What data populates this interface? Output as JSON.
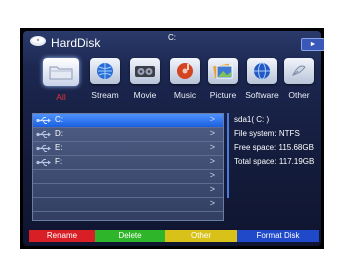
{
  "header": {
    "title": "HardDisk",
    "drive_path": "C:",
    "nav_button_symbol": "►"
  },
  "categories": [
    {
      "label": "All",
      "icon": "folder-icon",
      "active": true
    },
    {
      "label": "Stream",
      "icon": "stream-icon",
      "active": false
    },
    {
      "label": "Movie",
      "icon": "movie-icon",
      "active": false
    },
    {
      "label": "Music",
      "icon": "music-icon",
      "active": false
    },
    {
      "label": "Picture",
      "icon": "picture-icon",
      "active": false
    },
    {
      "label": "Software",
      "icon": "software-icon",
      "active": false
    },
    {
      "label": "Other",
      "icon": "other-icon",
      "active": false
    }
  ],
  "file_list": {
    "rows": [
      {
        "name": "C:",
        "icon": "usb-icon",
        "arrow": ">",
        "selected": true
      },
      {
        "name": "D:",
        "icon": "usb-icon",
        "arrow": ">",
        "selected": false
      },
      {
        "name": "E:",
        "icon": "usb-icon",
        "arrow": ">",
        "selected": false
      },
      {
        "name": "F:",
        "icon": "usb-icon",
        "arrow": ">",
        "selected": false
      },
      {
        "name": "",
        "icon": "",
        "arrow": ">",
        "selected": false
      },
      {
        "name": "",
        "icon": "",
        "arrow": ">",
        "selected": false
      },
      {
        "name": "",
        "icon": "",
        "arrow": ">",
        "selected": false
      }
    ]
  },
  "info": {
    "device": "sda1( C: )",
    "file_system": "File system:  NTFS",
    "free_space": "Free space:  115.68GB",
    "total_space": "Total space:  117.19GB"
  },
  "buttons": [
    {
      "label": "Rename",
      "color": "#d81f26"
    },
    {
      "label": "Delete",
      "color": "#2fb52a"
    },
    {
      "label": "Other",
      "color": "#d8c21a"
    },
    {
      "label": "Format Disk",
      "color": "#1f49c8"
    }
  ],
  "colors": {
    "active_category": "#e53030",
    "selection": "#2f7bff",
    "panel": "#1c2750"
  }
}
